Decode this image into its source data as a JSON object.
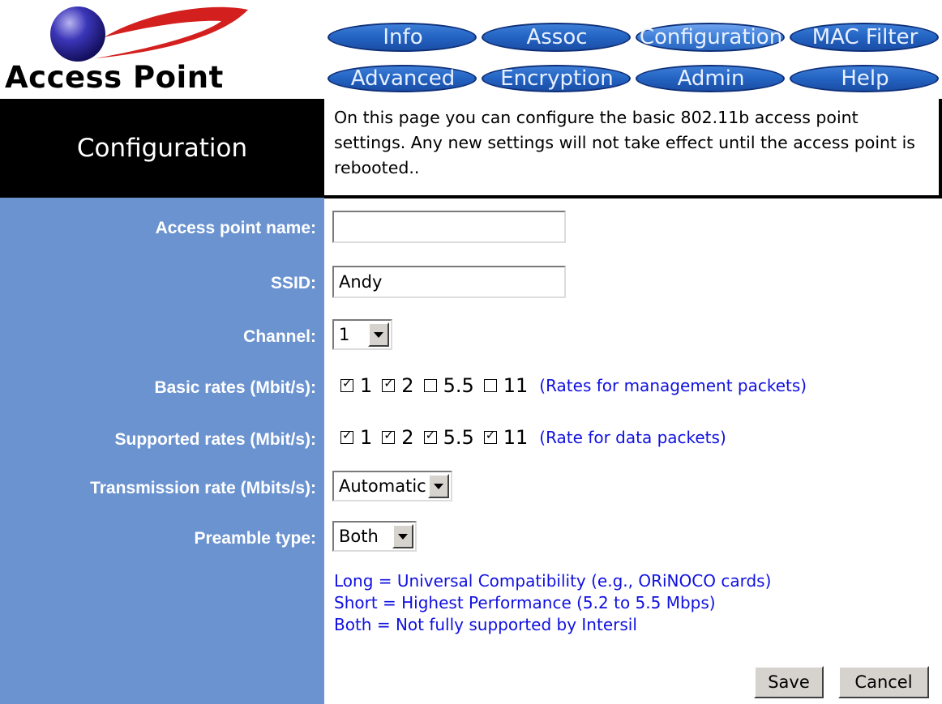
{
  "header": {
    "logo_text": "Access Point"
  },
  "nav": {
    "row1": [
      {
        "label": "Info",
        "active": false
      },
      {
        "label": "Assoc",
        "active": false
      },
      {
        "label": "Configuration",
        "active": true
      },
      {
        "label": "MAC Filter",
        "active": false
      }
    ],
    "row2": [
      {
        "label": "Advanced",
        "active": false
      },
      {
        "label": "Encryption",
        "active": false
      },
      {
        "label": "Admin",
        "active": false
      },
      {
        "label": "Help",
        "active": false
      }
    ]
  },
  "page": {
    "title": "Configuration",
    "description": "On this page you can configure the basic 802.11b access point settings. Any new settings will not take effect until the access point is rebooted.."
  },
  "form": {
    "ap_name": {
      "label": "Access point name:",
      "value": ""
    },
    "ssid": {
      "label": "SSID:",
      "value": "Andy"
    },
    "channel": {
      "label": "Channel:",
      "value": "1"
    },
    "basic_rates": {
      "label": "Basic rates (Mbit/s):",
      "rates": [
        {
          "value": "1",
          "checked": true
        },
        {
          "value": "2",
          "checked": true
        },
        {
          "value": "5.5",
          "checked": false
        },
        {
          "value": "11",
          "checked": false
        }
      ],
      "note": "(Rates for management packets)"
    },
    "supported_rates": {
      "label": "Supported rates (Mbit/s):",
      "rates": [
        {
          "value": "1",
          "checked": true
        },
        {
          "value": "2",
          "checked": true
        },
        {
          "value": "5.5",
          "checked": true
        },
        {
          "value": "11",
          "checked": true
        }
      ],
      "note": "(Rate for data packets)"
    },
    "tx_rate": {
      "label": "Transmission rate (Mbits/s):",
      "value": "Automatic"
    },
    "preamble": {
      "label": "Preamble type:",
      "value": "Both"
    },
    "legend": [
      "Long = Universal Compatibility (e.g., ORiNOCO cards)",
      "Short = Highest Performance (5.2 to 5.5 Mbps)",
      "Both = Not fully supported by Intersil"
    ],
    "save_label": "Save",
    "cancel_label": "Cancel"
  },
  "colors": {
    "panel": "#6b93d0",
    "nav_button": "#2565c4",
    "note_text": "#1010e0"
  }
}
